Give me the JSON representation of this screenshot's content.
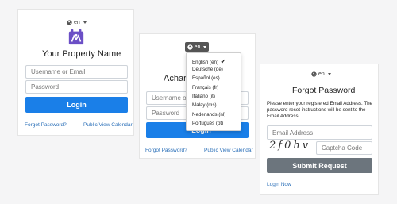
{
  "language": {
    "current": "en",
    "options": [
      {
        "label": "English (en)",
        "selected": true
      },
      {
        "label": "Deutsche (de)"
      },
      {
        "label": "Español (es)"
      },
      {
        "label": "Français (fr)"
      },
      {
        "label": "Italiano (it)"
      },
      {
        "label": "Malay (ms)"
      },
      {
        "label": "Nederlands (nl)"
      },
      {
        "label": "Portugués (pt)"
      }
    ]
  },
  "login1": {
    "title": "Your Property Name",
    "username_placeholder": "Username or Email",
    "password_placeholder": "Password",
    "login_label": "Login",
    "forgot_label": "Forgot Password?",
    "calendar_label": "Public View Calendar"
  },
  "login2": {
    "title_partial": "Achara",
    "username_partial": "Username o",
    "password_placeholder": "Password",
    "login_partial": "Login",
    "forgot_label": "Forgot Password?",
    "calendar_label": "Public View Calendar"
  },
  "forgot": {
    "title": "Forgot Password",
    "description": "Please enter your registered Email Address. The password reset instructions will be sent to the Email Address.",
    "email_placeholder": "Email Address",
    "captcha_text": "2f0hv",
    "captcha_placeholder": "Captcha Code",
    "submit_label": "Submit Request",
    "login_now_label": "Login Now"
  },
  "colors": {
    "primary": "#1a7fe8",
    "submit_gray": "#6c757d",
    "link": "#2a6fb8",
    "logo_purple": "#6b4fc6"
  }
}
